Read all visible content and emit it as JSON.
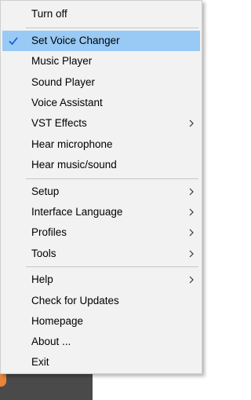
{
  "menu": {
    "group1": [
      {
        "label": "Turn off",
        "checked": false,
        "submenu": false
      }
    ],
    "group2": [
      {
        "label": "Set Voice Changer",
        "checked": true,
        "submenu": false,
        "highlighted": true
      },
      {
        "label": "Music Player",
        "checked": false,
        "submenu": false
      },
      {
        "label": "Sound Player",
        "checked": false,
        "submenu": false
      },
      {
        "label": "Voice Assistant",
        "checked": false,
        "submenu": false
      },
      {
        "label": "VST Effects",
        "checked": false,
        "submenu": true
      },
      {
        "label": "Hear microphone",
        "checked": false,
        "submenu": false
      },
      {
        "label": "Hear music/sound",
        "checked": false,
        "submenu": false
      }
    ],
    "group3": [
      {
        "label": "Setup",
        "checked": false,
        "submenu": true
      },
      {
        "label": "Interface Language",
        "checked": false,
        "submenu": true
      },
      {
        "label": "Profiles",
        "checked": false,
        "submenu": true
      },
      {
        "label": "Tools",
        "checked": false,
        "submenu": true
      }
    ],
    "group4": [
      {
        "label": "Help",
        "checked": false,
        "submenu": true
      },
      {
        "label": "Check for Updates",
        "checked": false,
        "submenu": false
      },
      {
        "label": "Homepage",
        "checked": false,
        "submenu": false
      },
      {
        "label": "About ...",
        "checked": false,
        "submenu": false
      },
      {
        "label": "Exit",
        "checked": false,
        "submenu": false
      }
    ]
  },
  "colors": {
    "menu_background": "#f2f2f2",
    "highlight": "#99c9f5",
    "check_mark": "#0a5fc4",
    "separator": "#c6c6c6",
    "taskbar": "#4a4a4a",
    "taskbar_icon": "#e8853a"
  },
  "icons": {
    "check": "check-icon",
    "submenu_arrow": "chevron-right-icon"
  }
}
